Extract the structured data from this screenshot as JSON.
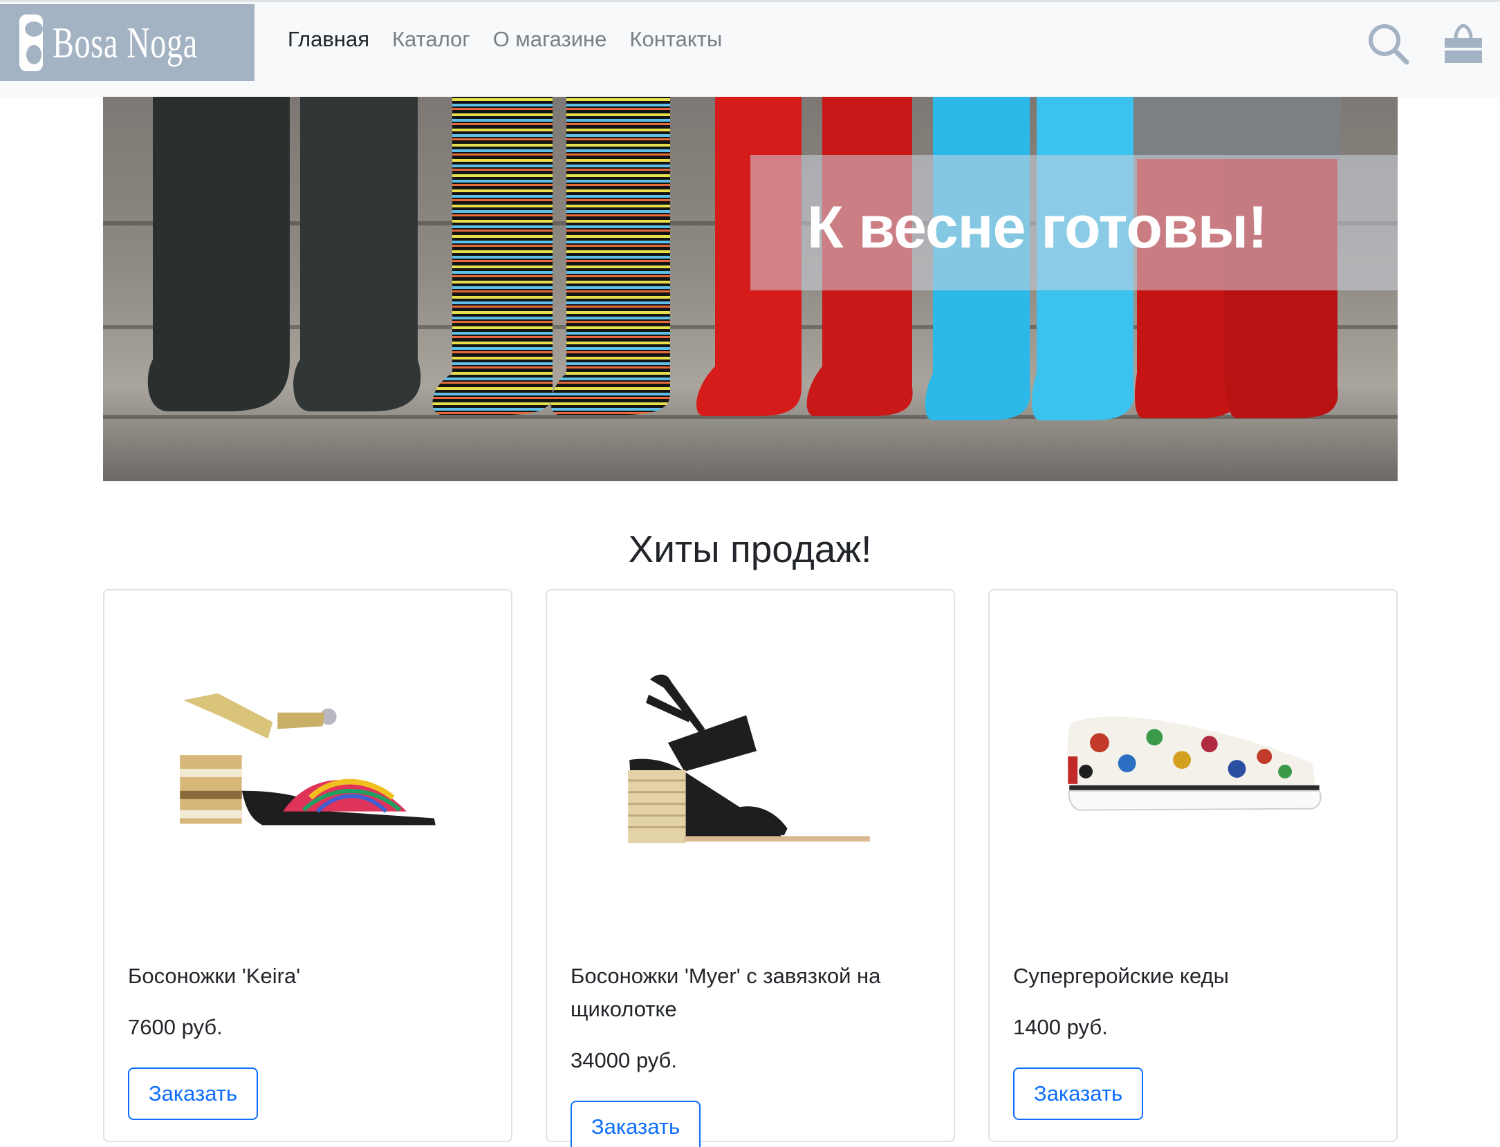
{
  "brand": {
    "name": "Bosa Noga"
  },
  "nav": {
    "items": [
      {
        "label": "Главная",
        "active": true
      },
      {
        "label": "Каталог",
        "active": false
      },
      {
        "label": "О магазине",
        "active": false
      },
      {
        "label": "Контакты",
        "active": false
      }
    ],
    "icons": [
      "search-icon",
      "cart-icon"
    ]
  },
  "banner": {
    "headline": "К весне готовы!"
  },
  "section": {
    "title": "Хиты продаж!"
  },
  "products": [
    {
      "title": "Босоножки 'Keira'",
      "price": "7600 руб.",
      "button": "Заказать"
    },
    {
      "title": "Босоножки 'Myer' с завязкой на щиколотке",
      "price": "34000 руб.",
      "button": "Заказать"
    },
    {
      "title": "Супергеройские кеды",
      "price": "1400 руб.",
      "button": "Заказать"
    }
  ],
  "colors": {
    "accent": "#0d6efd",
    "navbar": "#f8f9fa",
    "logo_bg": "#a4b3c4"
  }
}
